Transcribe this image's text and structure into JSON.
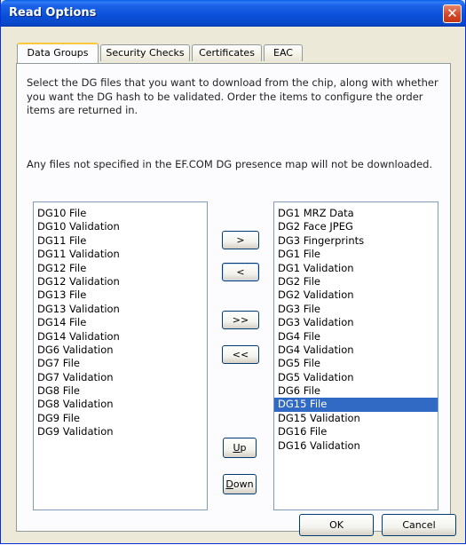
{
  "dialog": {
    "title": "Read Options",
    "close_glyph": "✕"
  },
  "tabs": [
    {
      "label": "Data Groups"
    },
    {
      "label": "Security Checks"
    },
    {
      "label": "Certificates"
    },
    {
      "label": "EAC"
    }
  ],
  "instructions": "Select the DG files that you want to download from the chip, along with whether you want the DG hash to be validated. Order the items to configure the order items are returned in.",
  "note": "Any files not specified in the EF.COM DG presence map will not be downloaded.",
  "available_list": [
    "DG10 File",
    "DG10 Validation",
    "DG11 File",
    "DG11 Validation",
    "DG12 File",
    "DG12 Validation",
    "DG13 File",
    "DG13 Validation",
    "DG14 File",
    "DG14 Validation",
    "DG6 Validation",
    "DG7 File",
    "DG7 Validation",
    "DG8 File",
    "DG8 Validation",
    "DG9 File",
    "DG9 Validation"
  ],
  "selected_list": [
    "DG1 MRZ Data",
    "DG2 Face JPEG",
    "DG3 Fingerprints",
    "DG1 File",
    "DG1 Validation",
    "DG2 File",
    "DG2 Validation",
    "DG3 File",
    "DG3 Validation",
    "DG4 File",
    "DG4 Validation",
    "DG5 File",
    "DG5 Validation",
    "DG6 File",
    "DG15 File",
    "DG15 Validation",
    "DG16 File",
    "DG16 Validation"
  ],
  "selected_item": "DG15 File",
  "move_buttons": {
    "add": ">",
    "remove": "<",
    "add_all": ">>",
    "remove_all": "<<",
    "up_mnemonic": "U",
    "up_rest": "p",
    "down_mnemonic": "D",
    "down_rest": "own"
  },
  "footer": {
    "ok": "OK",
    "cancel": "Cancel"
  },
  "colors": {
    "selection": "#316ac5",
    "titlebar": "#0a4fd8",
    "tab_highlight": "#ffc83c"
  }
}
